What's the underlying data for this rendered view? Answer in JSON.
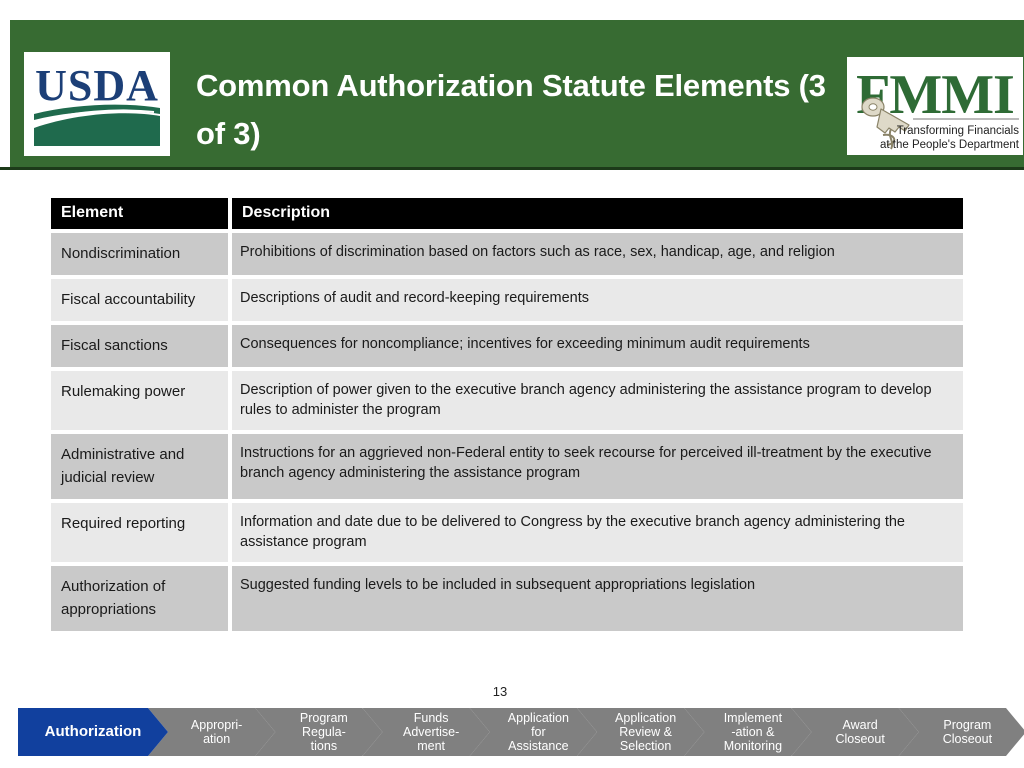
{
  "header": {
    "title": "Common Authorization Statute Elements (3 of 3)",
    "green": "#376b32",
    "usda_logo": {
      "name": "usda-logo",
      "wordmark": "USDA",
      "navy": "#1c3f77",
      "green": "#1f6a4d"
    },
    "fmmi_logo": {
      "name": "fmmi-logo",
      "wordmark": "FMMI",
      "tagline_line1": "Transforming Financials",
      "tagline_line2": "at the People's Department",
      "green": "#2e6b35"
    }
  },
  "table": {
    "columns": [
      "Element",
      "Description"
    ],
    "rows": [
      {
        "element": "Nondiscrimination",
        "description": "Prohibitions of discrimination based on factors such as race, sex, handicap, age, and religion"
      },
      {
        "element": "Fiscal accountability",
        "description": "Descriptions of audit and record-keeping requirements"
      },
      {
        "element": "Fiscal sanctions",
        "description": "Consequences for noncompliance; incentives for exceeding minimum audit requirements"
      },
      {
        "element": "Rulemaking power",
        "description": "Description of power given to the executive branch agency administering the assistance program to develop rules to administer the program"
      },
      {
        "element": "Administrative and judicial review",
        "description": "Instructions for an aggrieved non-Federal entity to seek recourse for perceived ill-treatment by the executive branch agency administering the assistance program"
      },
      {
        "element": "Required reporting",
        "description": "Information and date due to be delivered to Congress by the executive branch agency administering the assistance program"
      },
      {
        "element": "Authorization of appropriations",
        "description": "Suggested funding levels to be included in subsequent appropriations legislation"
      }
    ]
  },
  "page_number": "13",
  "process_flow": {
    "active_color": "#11409e",
    "inactive_color": "#808080",
    "steps": [
      {
        "label": "Authorization",
        "active": true
      },
      {
        "label": "Appropri-\nation",
        "active": false
      },
      {
        "label": "Program\nRegula-\ntions",
        "active": false
      },
      {
        "label": "Funds\nAdvertise-\nment",
        "active": false
      },
      {
        "label": "Application\nfor\nAssistance",
        "active": false
      },
      {
        "label": "Application\nReview &\nSelection",
        "active": false
      },
      {
        "label": "Implement\n-ation &\nMonitoring",
        "active": false
      },
      {
        "label": "Award\nCloseout",
        "active": false
      },
      {
        "label": "Program\nCloseout",
        "active": false
      }
    ]
  }
}
